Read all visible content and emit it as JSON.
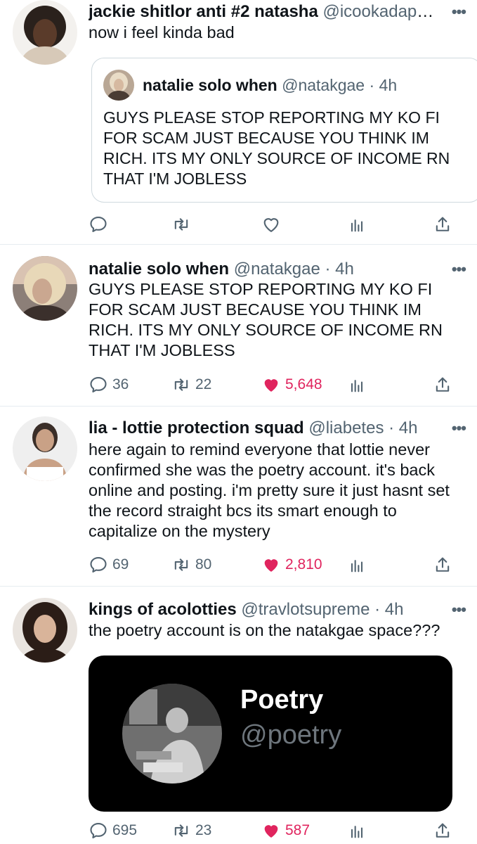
{
  "tweets": [
    {
      "name": "jackie shitlor anti #2 natasha",
      "handle": "@icookadapi…",
      "text": "now i feel kinda bad",
      "quote": {
        "name": "natalie solo when",
        "handle": "@natakgae",
        "time": "· 4h",
        "text": "GUYS PLEASE STOP REPORTING MY KO FI FOR SCAM JUST BECAUSE YOU THINK IM RICH. ITS MY ONLY SOURCE OF INCOME RN THAT I'M JOBLESS"
      }
    },
    {
      "name": "natalie solo when",
      "handle": "@natakgae",
      "time": "· 4h",
      "text": "GUYS PLEASE STOP REPORTING MY KO FI FOR SCAM JUST BECAUSE YOU THINK IM RICH. ITS MY ONLY SOURCE OF INCOME RN THAT I'M JOBLESS",
      "replies": "36",
      "retweets": "22",
      "likes": "5,648"
    },
    {
      "name": "lia - lottie protection squad",
      "handle": "@liabetes",
      "time": "· 4h",
      "text": "here again to remind everyone that lottie never confirmed she was the poetry account. it's back online and posting. i'm pretty sure it just hasnt set the record straight bcs its smart enough to capitalize on the mystery",
      "replies": "69",
      "retweets": "80",
      "likes": "2,810"
    },
    {
      "name": "kings of acolotties",
      "handle": "@travlotsupreme",
      "time": "· 4h",
      "text": "the poetry account is on the natakgae space???",
      "media": {
        "name": "Poetry",
        "handle": "@poetry"
      },
      "replies": "695",
      "retweets": "23",
      "likes": "587"
    }
  ],
  "more_label": "•••",
  "colors": {
    "like": "#e0245e",
    "icon": "#536471",
    "border": "#e6ecf0"
  },
  "icons": [
    "reply-icon",
    "retweet-icon",
    "like-icon",
    "analytics-icon",
    "share-icon",
    "more-icon"
  ]
}
